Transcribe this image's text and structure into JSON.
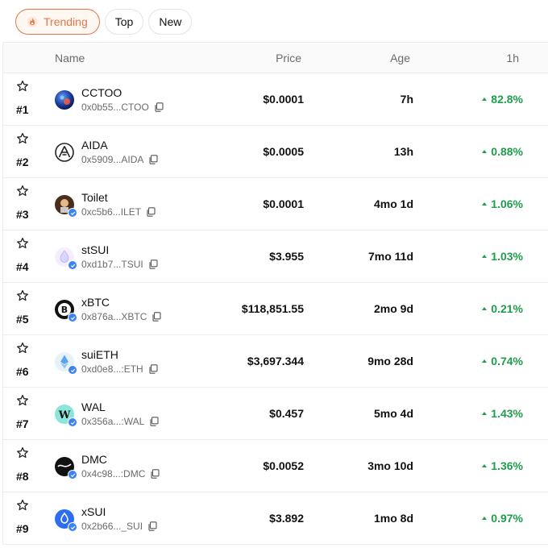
{
  "tabs": [
    {
      "label": "Trending",
      "active": true,
      "icon": "flame-icon"
    },
    {
      "label": "Top",
      "active": false
    },
    {
      "label": "New",
      "active": false
    }
  ],
  "columns": {
    "name": "Name",
    "price": "Price",
    "age": "Age",
    "change": "1h"
  },
  "colors": {
    "accent": "#e0784a",
    "positive": "#1e9d4b",
    "verified": "#3b82f6"
  },
  "tokens": [
    {
      "rank": "#1",
      "name": "CCTOO",
      "address": "0x0b55...CTOO",
      "price": "$0.0001",
      "age": "7h",
      "change": "82.8%",
      "verified": false,
      "icon": "cctoo-logo-icon"
    },
    {
      "rank": "#2",
      "name": "AIDA",
      "address": "0x5909...AIDA",
      "price": "$0.0005",
      "age": "13h",
      "change": "0.88%",
      "verified": false,
      "icon": "aida-logo-icon"
    },
    {
      "rank": "#3",
      "name": "Toilet",
      "address": "0xc5b6...ILET",
      "price": "$0.0001",
      "age": "4mo 1d",
      "change": "1.06%",
      "verified": true,
      "icon": "toilet-logo-icon"
    },
    {
      "rank": "#4",
      "name": "stSUI",
      "address": "0xd1b7...TSUI",
      "price": "$3.955",
      "age": "7mo 11d",
      "change": "1.03%",
      "verified": true,
      "icon": "stsui-logo-icon"
    },
    {
      "rank": "#5",
      "name": "xBTC",
      "address": "0x876a...XBTC",
      "price": "$118,851.55",
      "age": "2mo 9d",
      "change": "0.21%",
      "verified": true,
      "icon": "xbtc-logo-icon"
    },
    {
      "rank": "#6",
      "name": "suiETH",
      "address": "0xd0e8...:ETH",
      "price": "$3,697.344",
      "age": "9mo 28d",
      "change": "0.74%",
      "verified": true,
      "icon": "suieth-logo-icon"
    },
    {
      "rank": "#7",
      "name": "WAL",
      "address": "0x356a...:WAL",
      "price": "$0.457",
      "age": "5mo 4d",
      "change": "1.43%",
      "verified": true,
      "icon": "wal-logo-icon"
    },
    {
      "rank": "#8",
      "name": "DMC",
      "address": "0x4c98...:DMC",
      "price": "$0.0052",
      "age": "3mo 10d",
      "change": "1.36%",
      "verified": true,
      "icon": "dmc-logo-icon"
    },
    {
      "rank": "#9",
      "name": "xSUI",
      "address": "0x2b66..._SUI",
      "price": "$3.892",
      "age": "1mo 8d",
      "change": "0.97%",
      "verified": true,
      "icon": "xsui-logo-icon"
    }
  ]
}
